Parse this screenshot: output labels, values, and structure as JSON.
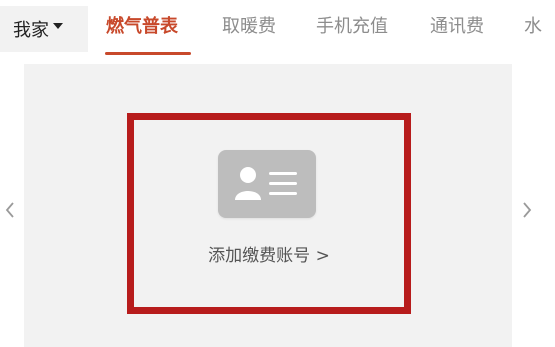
{
  "home_selector": {
    "label": "我家",
    "icon": "caret-down-icon"
  },
  "tabs": [
    {
      "label": "燃气普表",
      "active": true
    },
    {
      "label": "取暖费",
      "active": false
    },
    {
      "label": "手机充值",
      "active": false
    },
    {
      "label": "通讯费",
      "active": false
    },
    {
      "label": "水",
      "active": false
    }
  ],
  "card": {
    "icon": "id-card-icon",
    "add_account_label": "添加缴费账号 >"
  },
  "nav": {
    "prev_icon": "chevron-left-icon",
    "next_icon": "chevron-right-icon"
  },
  "colors": {
    "accent": "#c8492b",
    "highlight_border": "#b71c1c",
    "card_background": "#f2f2f2",
    "icon_gray": "#bdbdbd",
    "inactive_tab": "#8d8d8d"
  }
}
